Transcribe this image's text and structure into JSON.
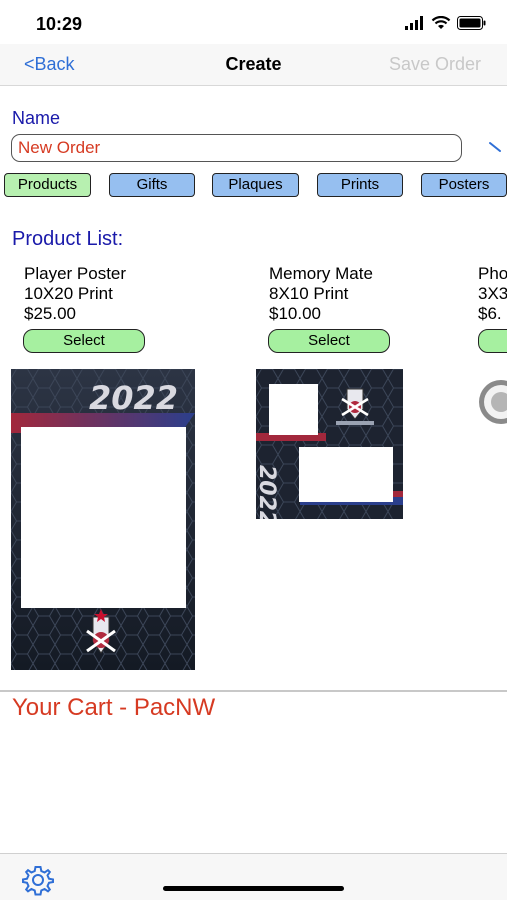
{
  "status": {
    "time": "10:29"
  },
  "nav": {
    "back": "<Back",
    "title": "Create",
    "save": "Save Order"
  },
  "name_section": {
    "label": "Name",
    "value": "New Order"
  },
  "categories": [
    "Products",
    "Gifts",
    "Plaques",
    "Prints",
    "Posters"
  ],
  "product_list_label": "Product List:",
  "products": [
    {
      "name": "Player Poster",
      "size": "10X20 Print",
      "price": "$25.00",
      "button": "Select"
    },
    {
      "name": "Memory Mate",
      "size": "8X10 Print",
      "price": "$10.00",
      "button": "Select"
    },
    {
      "name": "Pho",
      "size": "3X3",
      "price": "$6.",
      "button": ""
    }
  ],
  "poster_text": "2022",
  "cart": {
    "title": "Your Cart - PacNW"
  },
  "icons": [
    "wifi-icon",
    "battery-icon",
    "signal-icon",
    "chevron-icon",
    "gear-icon"
  ],
  "colors": {
    "accent": "#2f6fd6",
    "label_blue": "#1a1aaa",
    "red": "#d63a22",
    "green_btn": "#a6f0a0",
    "blue_btn": "#96bff0"
  }
}
